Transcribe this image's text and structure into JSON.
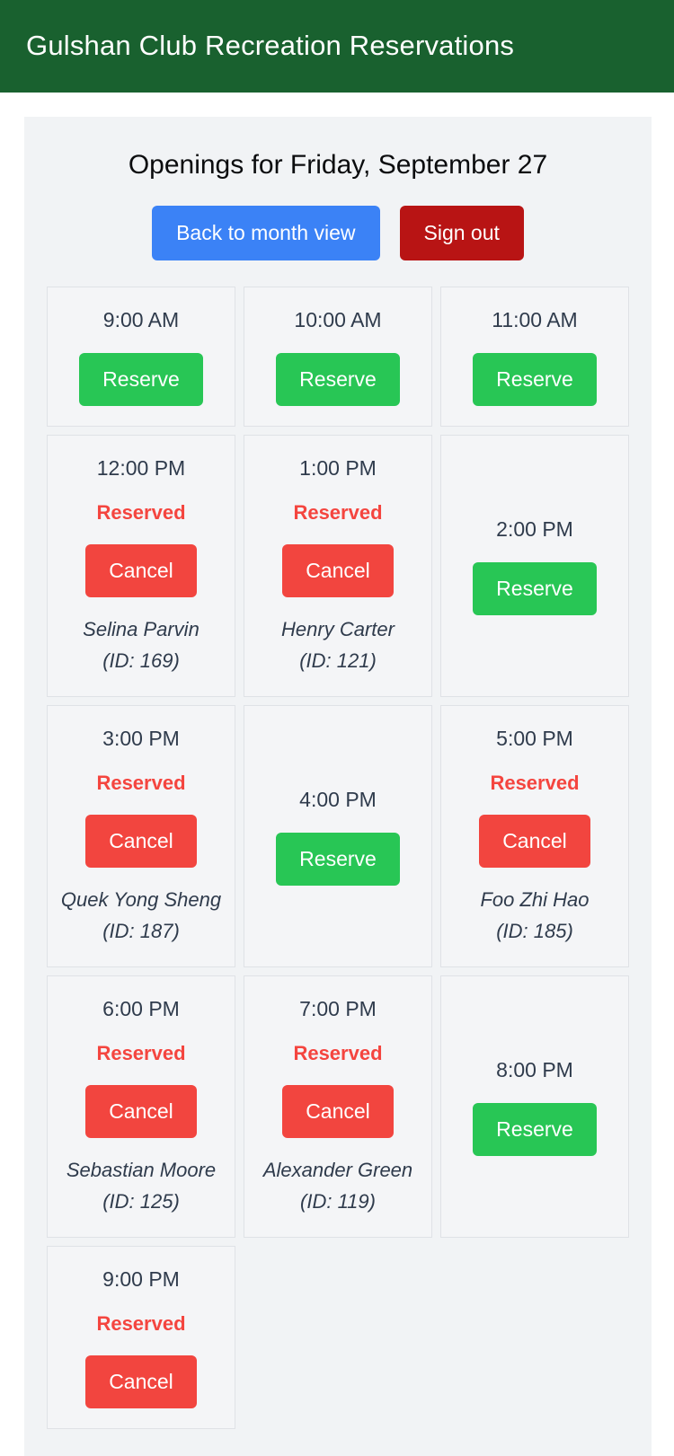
{
  "header": {
    "title": "Gulshan Club Recreation Reservations",
    "background_color": "#19612f",
    "text_color": "#ffffff"
  },
  "page": {
    "title": "Openings for Friday, September 27",
    "panel_background": "#f1f3f5"
  },
  "actions": {
    "back_label": "Back to month view",
    "back_color": "#3b82f6",
    "signout_label": "Sign out",
    "signout_color": "#b81414"
  },
  "labels": {
    "reserve": "Reserve",
    "cancel": "Cancel",
    "reserved": "Reserved",
    "reserved_color": "#f4453f",
    "reserve_color": "#28c655",
    "cancel_color": "#f2453f"
  },
  "slots": [
    {
      "time": "9:00 AM",
      "state": "available",
      "action": "Reserve",
      "status": "",
      "person": "",
      "person_id": ""
    },
    {
      "time": "10:00 AM",
      "state": "available",
      "action": "Reserve",
      "status": "",
      "person": "",
      "person_id": ""
    },
    {
      "time": "11:00 AM",
      "state": "available",
      "action": "Reserve",
      "status": "",
      "person": "",
      "person_id": ""
    },
    {
      "time": "12:00 PM",
      "state": "reserved",
      "action": "Cancel",
      "status": "Reserved",
      "person": "Selina Parvin",
      "person_id": "(ID: 169)"
    },
    {
      "time": "1:00 PM",
      "state": "reserved",
      "action": "Cancel",
      "status": "Reserved",
      "person": "Henry Carter",
      "person_id": "(ID: 121)"
    },
    {
      "time": "2:00 PM",
      "state": "available",
      "action": "Reserve",
      "status": "",
      "person": "",
      "person_id": ""
    },
    {
      "time": "3:00 PM",
      "state": "reserved",
      "action": "Cancel",
      "status": "Reserved",
      "person": "Quek Yong Sheng",
      "person_id": "(ID: 187)"
    },
    {
      "time": "4:00 PM",
      "state": "available",
      "action": "Reserve",
      "status": "",
      "person": "",
      "person_id": ""
    },
    {
      "time": "5:00 PM",
      "state": "reserved",
      "action": "Cancel",
      "status": "Reserved",
      "person": "Foo Zhi Hao",
      "person_id": "(ID: 185)"
    },
    {
      "time": "6:00 PM",
      "state": "reserved",
      "action": "Cancel",
      "status": "Reserved",
      "person": "Sebastian Moore",
      "person_id": "(ID: 125)"
    },
    {
      "time": "7:00 PM",
      "state": "reserved",
      "action": "Cancel",
      "status": "Reserved",
      "person": "Alexander Green",
      "person_id": "(ID: 119)"
    },
    {
      "time": "8:00 PM",
      "state": "available",
      "action": "Reserve",
      "status": "",
      "person": "",
      "person_id": ""
    },
    {
      "time": "9:00 PM",
      "state": "reserved",
      "action": "Cancel",
      "status": "Reserved",
      "person": "",
      "person_id": ""
    }
  ]
}
